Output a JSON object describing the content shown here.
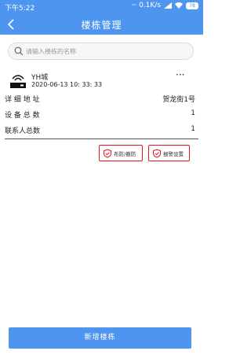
{
  "status_bar": {
    "time": "下午5:22",
    "net_speed": "0.1K/s",
    "battery": "78"
  },
  "nav": {
    "title": "楼栋管理"
  },
  "search": {
    "placeholder": "请输入楼栋的名称"
  },
  "building": {
    "name": "YH城",
    "datetime": "2020-06-13 10: 33: 33",
    "more": "···",
    "fields": [
      {
        "label": "详 细 地 址",
        "value": "贺龙街1号"
      },
      {
        "label": "设 备 总 数",
        "value": "1"
      },
      {
        "label": "联系人总数",
        "value": "1"
      }
    ],
    "actions": {
      "arm_disarm": "布防/撤防",
      "alarm_settings": "报警设置"
    }
  },
  "footer": {
    "add_label": "新增楼栋"
  },
  "colors": {
    "primary": "#4d95ef",
    "danger": "#e01818"
  }
}
